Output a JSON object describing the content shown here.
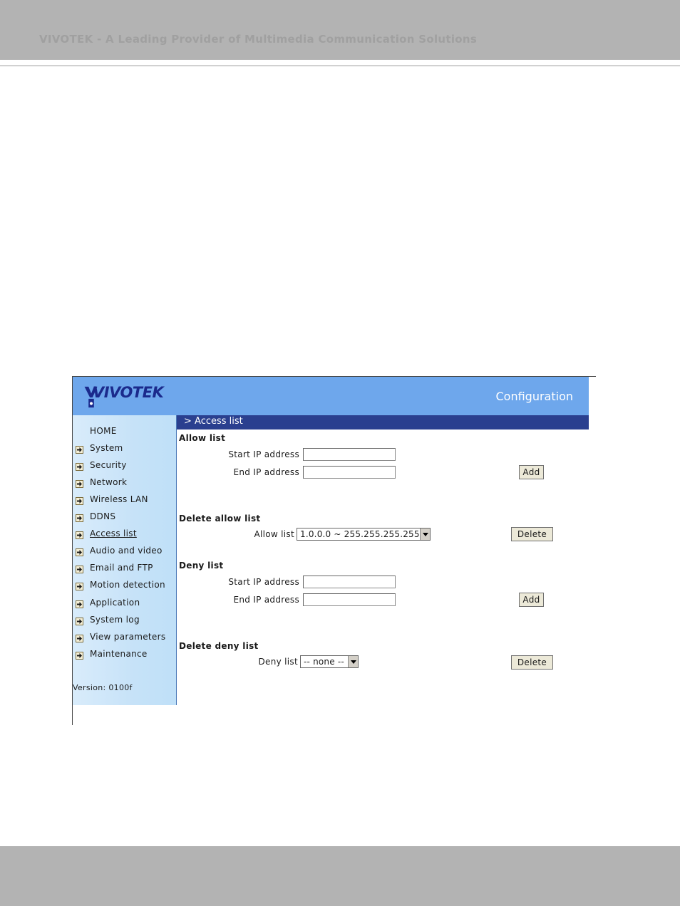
{
  "doc": {
    "header_text": "VIVOTEK - A Leading Provider of Multimedia Communication Solutions"
  },
  "app": {
    "brand": "VIVOTEK",
    "title": "Configuration",
    "page_title": "> Access list"
  },
  "sidebar": {
    "items": [
      {
        "label": "HOME",
        "icon": false
      },
      {
        "label": "System",
        "icon": true
      },
      {
        "label": "Security",
        "icon": true
      },
      {
        "label": "Network",
        "icon": true
      },
      {
        "label": "Wireless LAN",
        "icon": true
      },
      {
        "label": "DDNS",
        "icon": true
      },
      {
        "label": "Access list",
        "icon": true,
        "active": true
      },
      {
        "label": "Audio and video",
        "icon": true
      },
      {
        "label": "Email and FTP",
        "icon": true
      },
      {
        "label": "Motion detection",
        "icon": true
      },
      {
        "label": "Application",
        "icon": true
      },
      {
        "label": "System log",
        "icon": true
      },
      {
        "label": "View parameters",
        "icon": true
      },
      {
        "label": "Maintenance",
        "icon": true
      }
    ],
    "version": "Version: 0100f"
  },
  "allow_list": {
    "title": "Allow list",
    "start_label": "Start IP address",
    "start_value": "",
    "end_label": "End IP address",
    "end_value": "",
    "add_label": "Add"
  },
  "delete_allow": {
    "title": "Delete allow list",
    "list_label": "Allow list",
    "selected": "1.0.0.0 ~ 255.255.255.255",
    "delete_label": "Delete"
  },
  "deny_list": {
    "title": "Deny list",
    "start_label": "Start IP address",
    "start_value": "",
    "end_label": "End IP address",
    "end_value": "",
    "add_label": "Add"
  },
  "delete_deny": {
    "title": "Delete deny list",
    "list_label": "Deny list",
    "selected": "-- none --",
    "delete_label": "Delete"
  },
  "colors": {
    "header_bg": "#6ea7ec",
    "title_bar_bg": "#2a3f8f",
    "doc_band": "#b3b3b3"
  }
}
